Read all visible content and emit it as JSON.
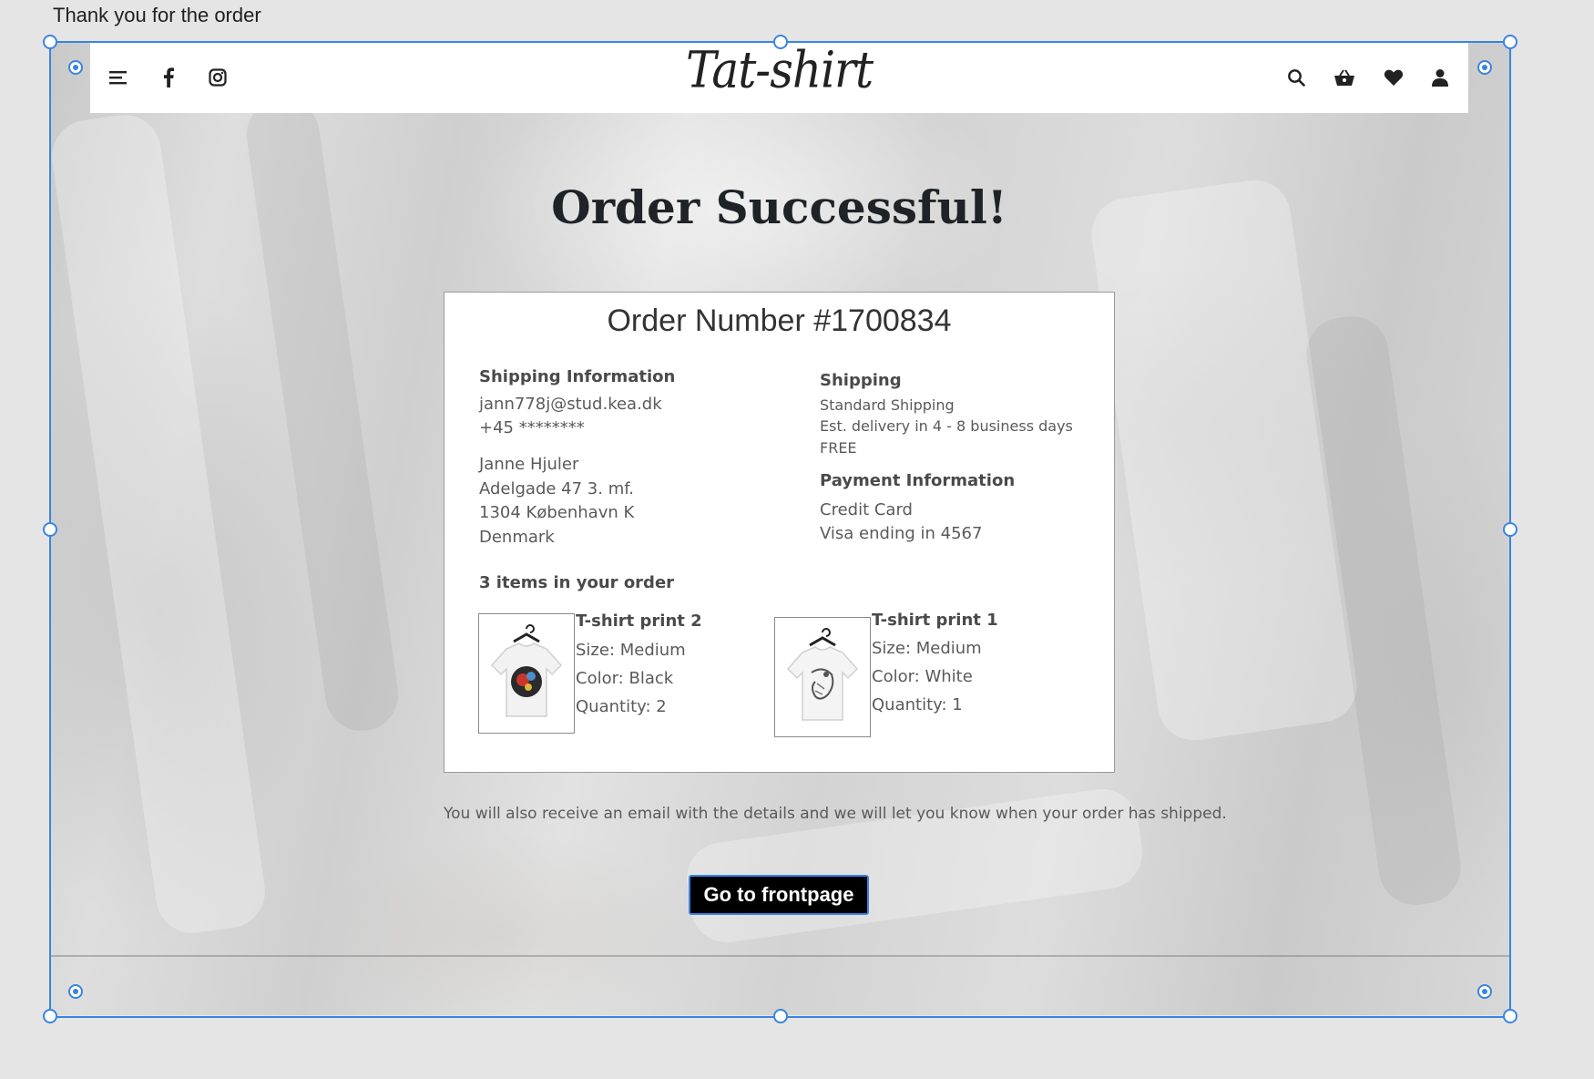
{
  "artboard": {
    "title": "Thank you for the order"
  },
  "header": {
    "logo_text": "Tat-shirt",
    "left_icons": [
      "menu-icon",
      "facebook-icon",
      "instagram-icon"
    ],
    "right_icons": [
      "search-icon",
      "basket-icon",
      "heart-icon",
      "user-icon"
    ]
  },
  "main": {
    "headline": "Order Successful!",
    "order": {
      "number_label": "Order Number #1700834",
      "shipping_info": {
        "title": "Shipping Information",
        "email": "jann778j@stud.kea.dk",
        "phone": "+45 ********",
        "name": "Janne Hjuler",
        "street": "Adelgade 47 3. mf.",
        "city": "1304 København K",
        "country": "Denmark"
      },
      "shipping": {
        "title": "Shipping",
        "method": "Standard Shipping",
        "estimate": "Est. delivery in 4 - 8 business days",
        "price": "FREE"
      },
      "payment": {
        "title": "Payment Information",
        "method": "Credit Card",
        "card": "Visa ending in 4567"
      },
      "items_title": "3 items in your order",
      "items": [
        {
          "name": "T-shirt print 2",
          "size": "Size: Medium",
          "color": "Color: Black",
          "quantity": "Quantity: 2"
        },
        {
          "name": "T-shirt print 1",
          "size": "Size: Medium",
          "color": "Color: White",
          "quantity": "Quantity: 1"
        }
      ]
    },
    "notice": "You will also receive an email with the details and we will let you know when your order has shipped.",
    "cta_label": "Go to frontpage"
  },
  "colors": {
    "selection": "#3a84e0",
    "button_bg": "#000000",
    "button_text": "#ffffff",
    "heading": "#1f2328"
  }
}
